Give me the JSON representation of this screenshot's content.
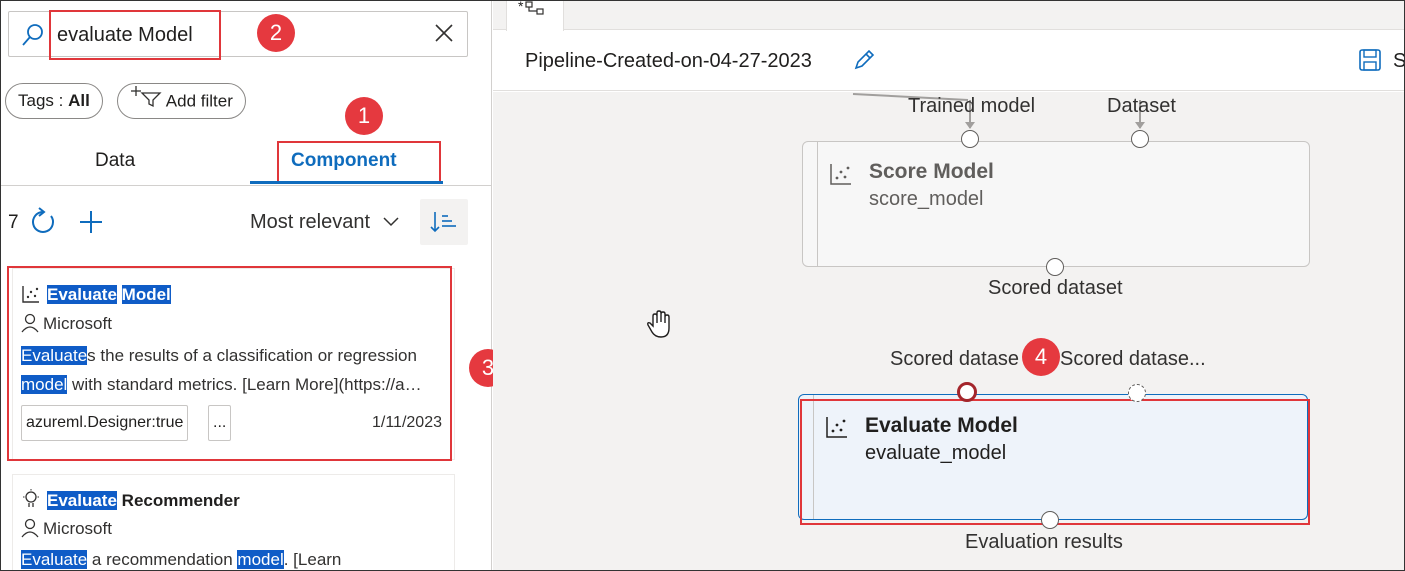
{
  "search": {
    "value": "evaluate Model"
  },
  "filters": {
    "tags_prefix": "Tags : ",
    "tags_value": "All",
    "add_filter": "Add filter"
  },
  "tabs": [
    {
      "label": "Data"
    },
    {
      "label": "Component"
    }
  ],
  "toolbar": {
    "count": "7",
    "sort_label": "Most relevant"
  },
  "badges": [
    "1",
    "2",
    "3",
    "4"
  ],
  "results": [
    {
      "title_a": "Evaluate",
      "title_b": "Model",
      "publisher": "Microsoft",
      "desc1_hl": "Evaluate",
      "desc1_rest": "s the results of a classification or regression",
      "desc2_hl": "model",
      "desc2_rest": " with standard metrics. [Learn More](https://a…",
      "tag": "azureml.Designer:true",
      "more": "...",
      "date": "1/11/2023"
    },
    {
      "title_a": "Evaluate",
      "title_b": " Recommender",
      "publisher": "Microsoft",
      "desc1_hl": "Evaluate",
      "desc1_mid": " a recommendation ",
      "desc1_hl2": "model",
      "desc1_rest": ". [Learn"
    }
  ],
  "pipeline": {
    "title": "Pipeline-Created-on-04-27-2023",
    "tab_glyph": "*",
    "save_partial": "S"
  },
  "canvas": {
    "score_node": {
      "name": "Score Model",
      "sub": "score_model",
      "in1": "Trained model",
      "in2": "Dataset",
      "out": "Scored dataset"
    },
    "evaluate_node": {
      "name": "Evaluate Model",
      "sub": "evaluate_model",
      "in1": "Scored datase",
      "in2": "Scored datase...",
      "out": "Evaluation results"
    }
  },
  "colors": {
    "accent": "#0f6cbd",
    "highlight": "#0f5cc7",
    "annotation": "#e0363a",
    "selected_port": "#a4262c"
  }
}
